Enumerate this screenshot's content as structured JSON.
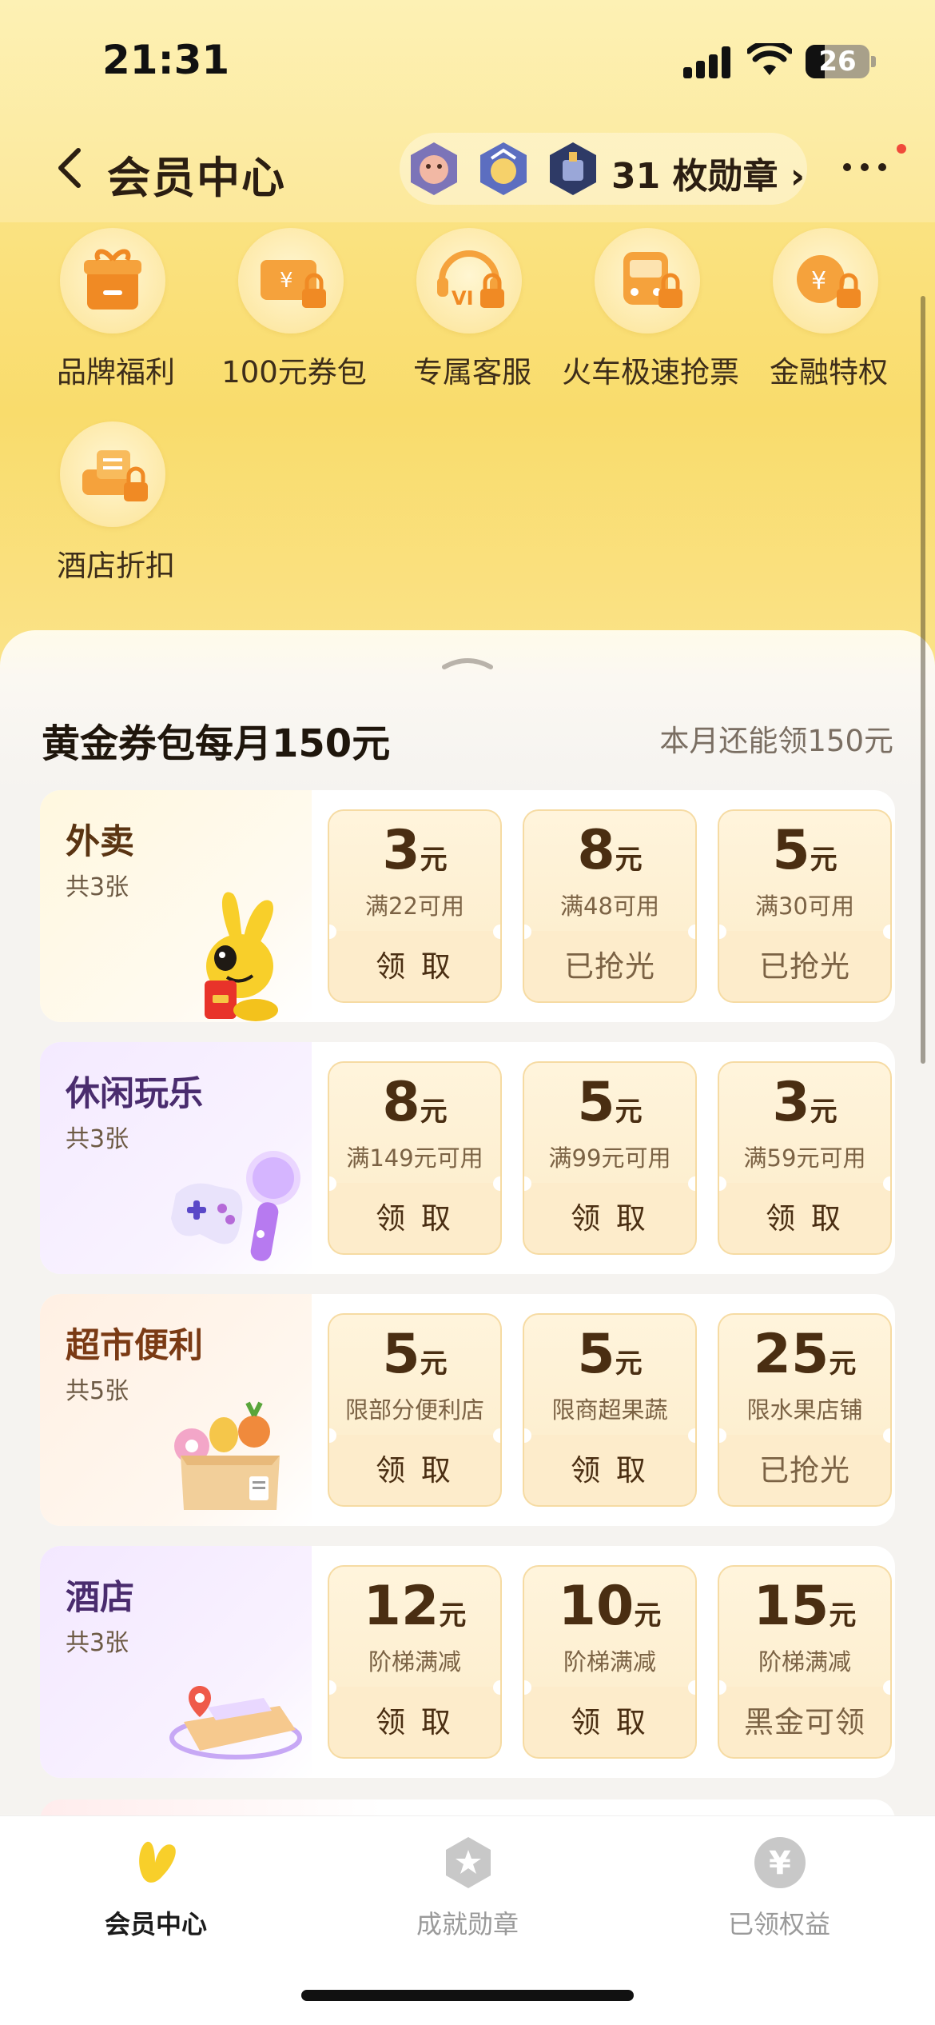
{
  "status_bar": {
    "time": "21:31",
    "battery": "26"
  },
  "nav": {
    "title": "会员中心",
    "medals_text": "31 枚勋章 ›"
  },
  "colors": {
    "accent": "#f9dc6c",
    "brand_orange": "#f08a24",
    "text_dark": "#2b1e12"
  },
  "benefits": [
    {
      "label": "品牌福利",
      "icon": "gift-icon",
      "locked": false
    },
    {
      "label": "100元券包",
      "icon": "coupon-icon",
      "locked": true
    },
    {
      "label": "专属客服",
      "icon": "headset-icon",
      "locked": true
    },
    {
      "label": "火车极速抢票",
      "icon": "train-icon",
      "locked": true
    },
    {
      "label": "金融特权",
      "icon": "finance-icon",
      "locked": true
    },
    {
      "label": "酒店折扣",
      "icon": "hotel-icon",
      "locked": true
    }
  ],
  "section": {
    "title": "黄金券包每月150元",
    "note": "本月还能领150元"
  },
  "categories": [
    {
      "name": "外卖",
      "count": "共3张",
      "name_color": "#5a3412",
      "coupons": [
        {
          "amount": "3",
          "unit": "元",
          "condition": "满22可用",
          "action": "领 取",
          "available": true
        },
        {
          "amount": "8",
          "unit": "元",
          "condition": "满48可用",
          "action": "已抢光",
          "available": false
        },
        {
          "amount": "5",
          "unit": "元",
          "condition": "满30可用",
          "action": "已抢光",
          "available": false
        }
      ]
    },
    {
      "name": "休闲玩乐",
      "count": "共3张",
      "name_color": "#4a2c6e",
      "coupons": [
        {
          "amount": "8",
          "unit": "元",
          "condition": "满149元可用",
          "action": "领 取",
          "available": true
        },
        {
          "amount": "5",
          "unit": "元",
          "condition": "满99元可用",
          "action": "领 取",
          "available": true
        },
        {
          "amount": "3",
          "unit": "元",
          "condition": "满59元可用",
          "action": "领 取",
          "available": true
        }
      ]
    },
    {
      "name": "超市便利",
      "count": "共5张",
      "name_color": "#7a3a14",
      "coupons": [
        {
          "amount": "5",
          "unit": "元",
          "condition": "限部分便利店",
          "action": "领 取",
          "available": true
        },
        {
          "amount": "5",
          "unit": "元",
          "condition": "限商超果蔬",
          "action": "领 取",
          "available": true
        },
        {
          "amount": "25",
          "unit": "元",
          "condition": "限水果店铺",
          "action": "已抢光",
          "available": false
        }
      ]
    },
    {
      "name": "酒店",
      "count": "共3张",
      "name_color": "#4a2c6e",
      "coupons": [
        {
          "amount": "12",
          "unit": "元",
          "condition": "阶梯满减",
          "action": "领 取",
          "available": true
        },
        {
          "amount": "10",
          "unit": "元",
          "condition": "阶梯满减",
          "action": "领 取",
          "available": true
        },
        {
          "amount": "15",
          "unit": "元",
          "condition": "阶梯满减",
          "action": "黑金可领",
          "available": false
        }
      ]
    }
  ],
  "tabbar": [
    {
      "label": "会员中心",
      "icon": "member-icon",
      "active": true
    },
    {
      "label": "成就勋章",
      "icon": "medal-icon",
      "active": false
    },
    {
      "label": "已领权益",
      "icon": "yen-icon",
      "active": false
    }
  ]
}
